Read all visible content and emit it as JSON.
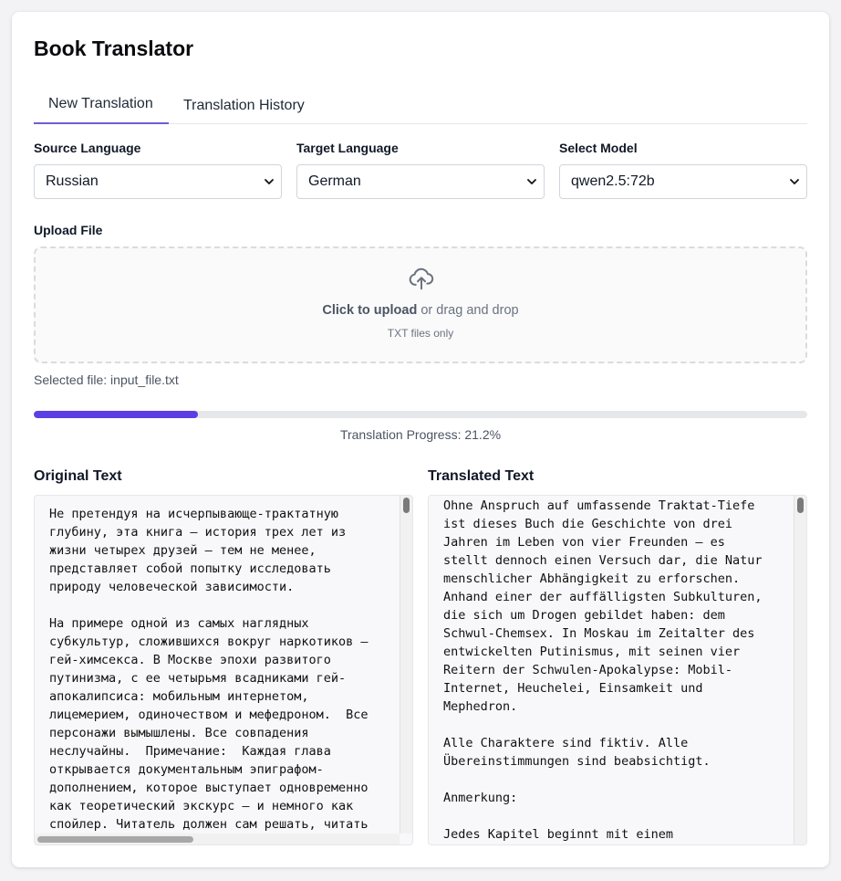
{
  "app": {
    "title": "Book Translator"
  },
  "tabs": [
    {
      "label": "New Translation",
      "active": true
    },
    {
      "label": "Translation History",
      "active": false
    }
  ],
  "form": {
    "source_label": "Source Language",
    "source_value": "Russian",
    "target_label": "Target Language",
    "target_value": "German",
    "model_label": "Select Model",
    "model_value": "qwen2.5:72b"
  },
  "upload": {
    "label": "Upload File",
    "cta_bold": "Click to upload",
    "cta_rest": " or drag and drop",
    "hint": "TXT files only",
    "selected_file": "Selected file: input_file.txt",
    "icon": "cloud-upload-icon"
  },
  "progress": {
    "percent": 21.2,
    "text": "Translation Progress: 21.2%"
  },
  "original": {
    "label": "Original Text",
    "text": "Не претендуя на исчерпывающе-трактатную\nглубину, эта книга – история трех лет из\nжизни четырех друзей – тем не менее,\nпредставляет собой попытку исследовать\nприроду человеческой зависимости.\n\nНа примере одной из самых наглядных\nсубкультур, сложившихся вокруг наркотиков –\nгей-химсекса. В Москве эпохи развитого\nпутинизма, с ее четырьмя всадниками гей-\nапокалипсиса: мобильным интернетом,\nлицемерием, одиночеством и мефедроном.  Все\nперсонажи вымышлены. Все совпадения\nнеслучайны.  Примечание:  Каждая глава\nоткрывается документальным эпиграфом-\nдополнением, которое выступает одновременно\nкак теоретический экскурс – и немного как\nспойлер. Читатель должен сам решать, читать"
  },
  "translated": {
    "label": "Translated Text",
    "text": "Ohne Anspruch auf umfassende Traktat-Tiefe\nist dieses Buch die Geschichte von drei\nJahren im Leben von vier Freunden – es\nstellt dennoch einen Versuch dar, die Natur\nmenschlicher Abhängigkeit zu erforschen.\nAnhand einer der auffälligsten Subkulturen,\ndie sich um Drogen gebildet haben: dem\nSchwul-Chemsex. In Moskau im Zeitalter des\nentwickelten Putinismus, mit seinen vier\nReitern der Schwulen-Apokalypse: Mobil-\nInternet, Heuchelei, Einsamkeit und\nMephedron.\n\nAlle Charaktere sind fiktiv. Alle\nÜbereinstimmungen sind beabsichtigt.\n\nAnmerkung:\n\nJedes Kapitel beginnt mit einem"
  },
  "colors": {
    "accent": "#5b3fe4",
    "tab_underline": "#6d5dd3"
  }
}
